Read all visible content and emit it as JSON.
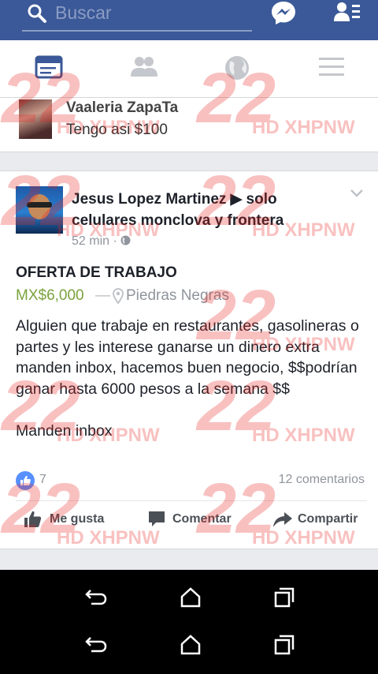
{
  "search": {
    "placeholder": "Buscar"
  },
  "tabs": [
    {
      "icon": "news-feed-icon",
      "active": true
    },
    {
      "icon": "friends-icon",
      "active": false
    },
    {
      "icon": "globe-icon",
      "active": false
    },
    {
      "icon": "menu-icon",
      "active": false
    }
  ],
  "prev_post": {
    "name": "Vaaleria ZapaTa",
    "text": "Tengo asi $100"
  },
  "post": {
    "author": "Jesus Lopez Martinez ▶ solo celulares monclova y frontera",
    "time": "52 min",
    "title": "OFERTA DE TRABAJO",
    "price": "MX$6,000",
    "location": "Piedras Negras",
    "body": "Alguien que trabaje en restaurantes, gasolineras o partes y les interese ganarse un dinero extra manden inbox, hacemos buen negocio, $$podrían ganar hasta 6000 pesos a la semana $$\n\nManden inbox",
    "likes": "7",
    "comments": "12 comentarios",
    "actions": {
      "like": "Me gusta",
      "comment": "Comentar",
      "share": "Compartir"
    }
  },
  "watermark": {
    "number": "22",
    "brand": "HD XHPNW"
  },
  "colors": {
    "brand_blue": "#3b5998",
    "price_green": "#7aa23d",
    "like_blue": "#5890ff"
  }
}
